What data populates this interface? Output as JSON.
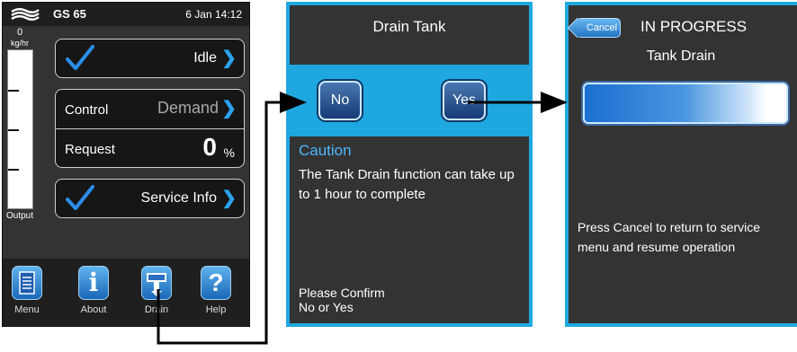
{
  "screen1": {
    "status_bar": {
      "model": "GS 65",
      "datetime": "6 Jan 14:12"
    },
    "gauge": {
      "value": "0",
      "unit": "kg/hr",
      "label": "Output"
    },
    "idle_button": {
      "label": "Idle"
    },
    "control": {
      "label": "Control",
      "value": "Demand"
    },
    "request": {
      "label": "Request",
      "value": "0",
      "unit": "%"
    },
    "service_info": {
      "label": "Service Info"
    },
    "nav": [
      {
        "label": "Menu",
        "icon": "document-icon"
      },
      {
        "label": "About",
        "icon": "info-icon"
      },
      {
        "label": "Drain",
        "icon": "drain-icon"
      },
      {
        "label": "Help",
        "icon": "help-icon"
      }
    ]
  },
  "screen2": {
    "title": "Drain Tank",
    "no_button": "No",
    "yes_button": "Yes",
    "caution_title": "Caution",
    "message": "The Tank Drain function can take up to 1 hour to complete",
    "confirm_line1": "Please Confirm",
    "confirm_line2": "No or Yes"
  },
  "screen3": {
    "cancel_button": "Cancel",
    "status": "IN PROGRESS",
    "subtitle": "Tank Drain",
    "progress_level": 0.9,
    "message": "Press Cancel to return to service menu and resume operation"
  },
  "colors": {
    "accent_blue": "#1fa8e0",
    "panel_dark": "#333333",
    "chevron": "#2aa3ee",
    "connector": "#000000"
  }
}
